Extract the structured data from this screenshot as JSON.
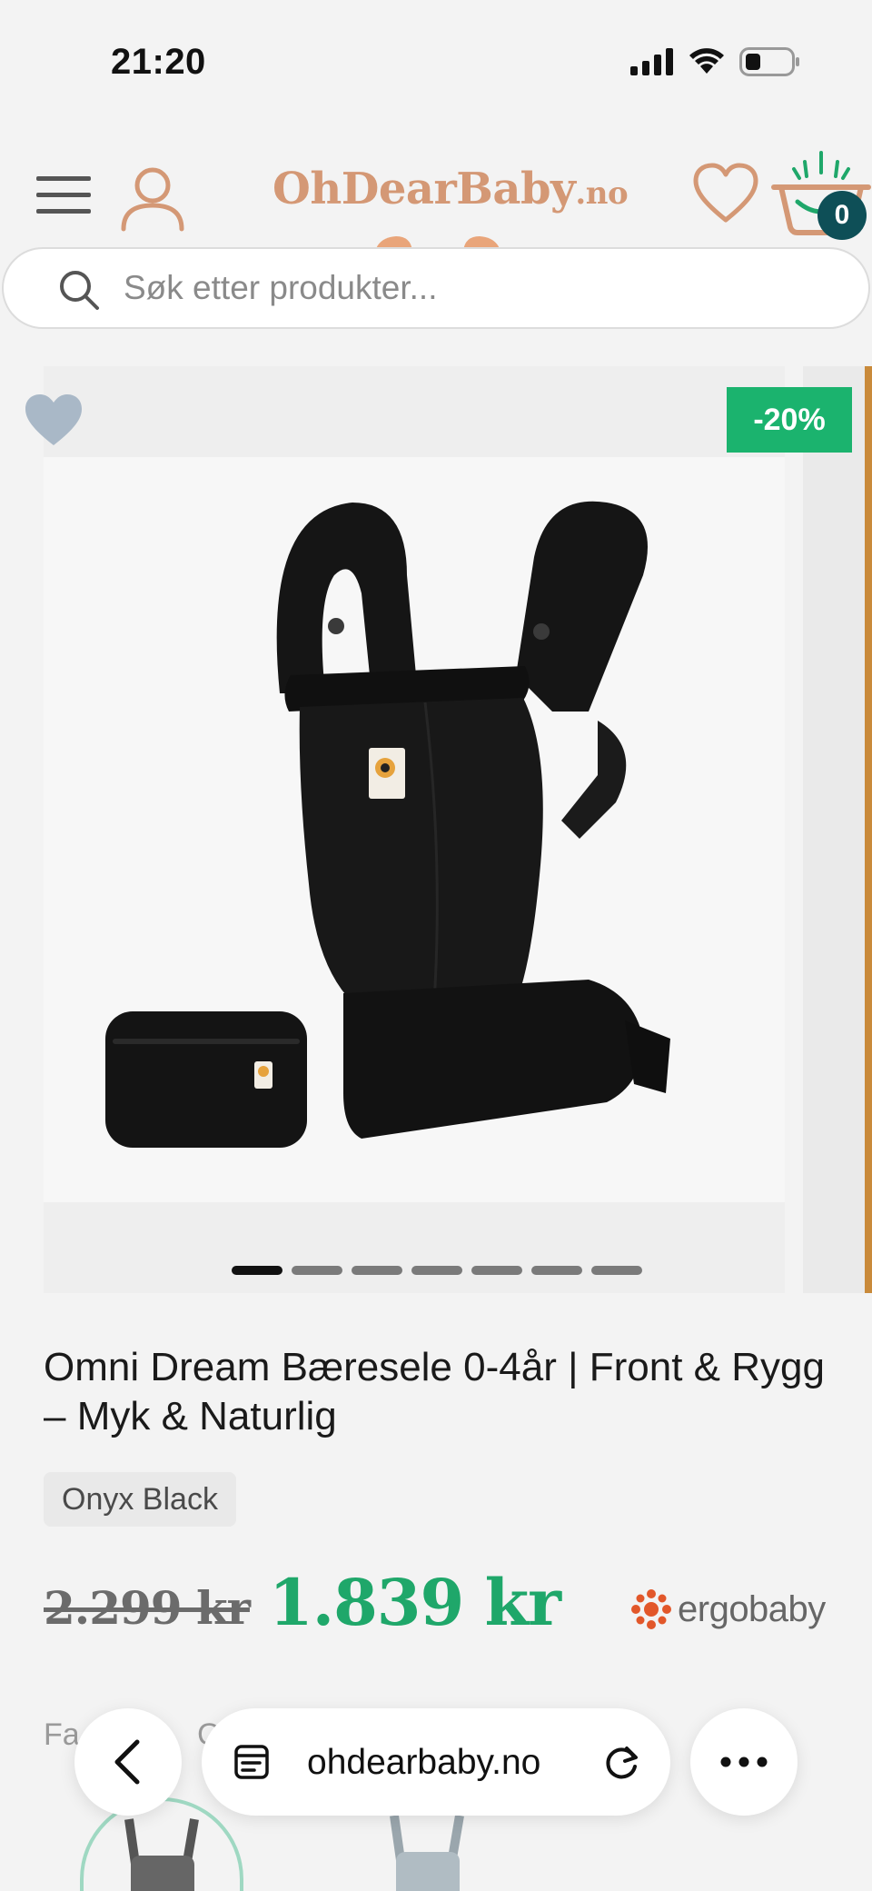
{
  "status_bar": {
    "time": "21:20"
  },
  "header": {
    "logo_main": "OhDearBaby",
    "logo_suffix": ".no",
    "cart_count": "0"
  },
  "search": {
    "placeholder": "Søk etter produkter..."
  },
  "gallery": {
    "discount": "-20%",
    "slide_count": 7,
    "active_slide": 1
  },
  "product": {
    "title": "Omni Dream Bæresele 0-4år | Front & Rygg – Myk & Naturlig",
    "variant": "Onyx Black",
    "old_price": "2.299 kr",
    "new_price": "1.839 kr",
    "brand": "ergobaby"
  },
  "color_section": {
    "label": "Fa",
    "value_partial": "Onyx"
  },
  "browser": {
    "url": "ohdearbaby.no"
  },
  "colors": {
    "accent": "#d49875",
    "price_green": "#1fa76a",
    "badge_green": "#1bb36e",
    "badge_dark": "#0e4f57"
  }
}
